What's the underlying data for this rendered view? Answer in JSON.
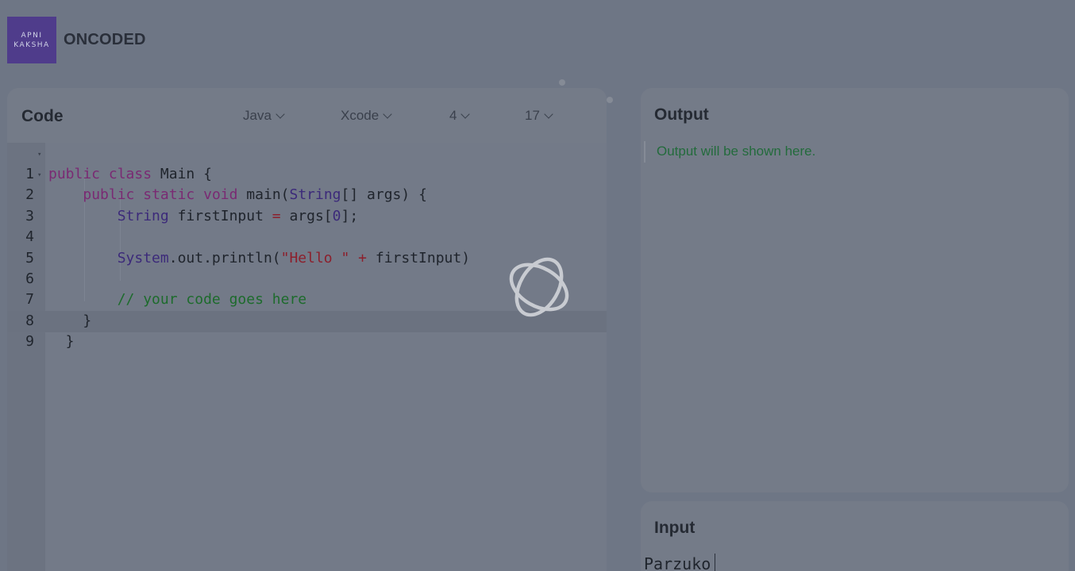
{
  "header": {
    "logo_line1": "APNI",
    "logo_line2": "KAKSHA",
    "brand": "ONCODED"
  },
  "code_panel": {
    "title": "Code",
    "language": "Java",
    "theme": "Xcode",
    "tab_size": "4",
    "font_size": "17",
    "line_numbers": [
      "1",
      "2",
      "3",
      "4",
      "5",
      "6",
      "7",
      "8",
      "9"
    ]
  },
  "output_panel": {
    "title": "Output",
    "placeholder": "Output will be shown here."
  },
  "input_panel": {
    "title": "Input",
    "value": "Parzuko"
  },
  "colors": {
    "logo_bg": "#4f3c8b",
    "output_text": "#236b3c",
    "keyword": "#7a2a73",
    "string": "#8c1f2c",
    "comment": "#1d6b2c"
  }
}
